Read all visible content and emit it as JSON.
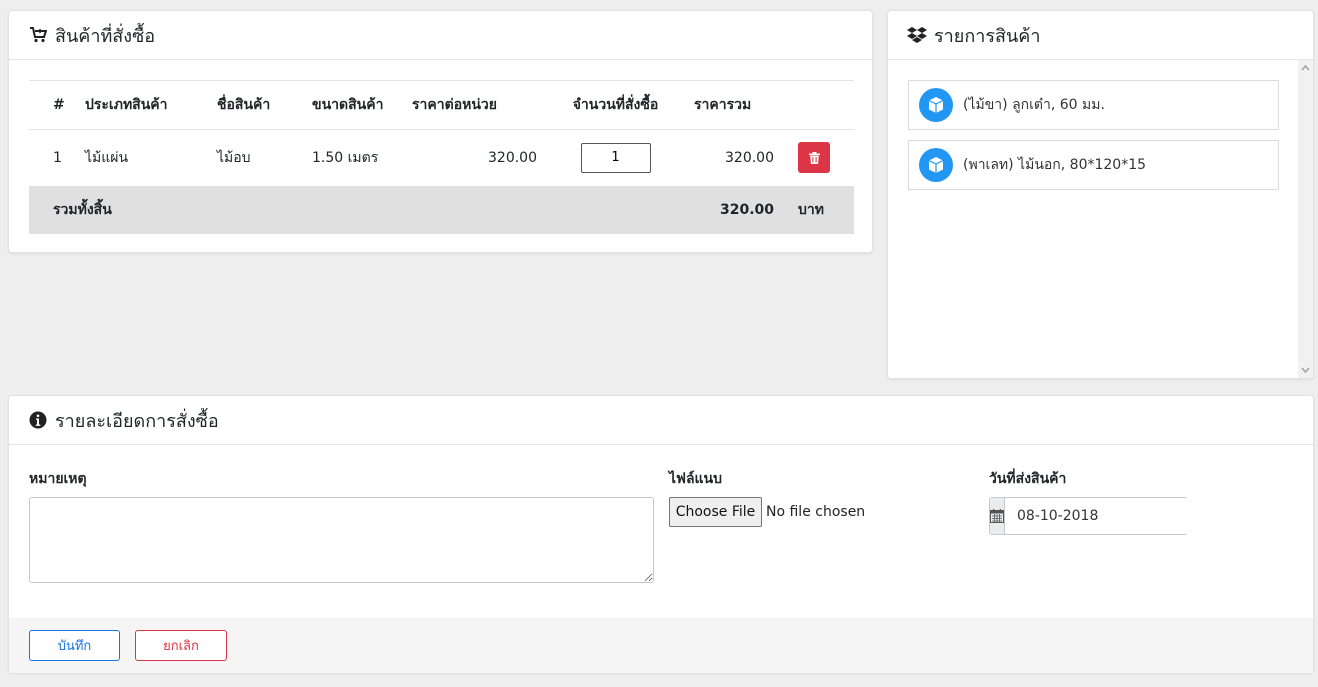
{
  "order": {
    "title": "สินค้าที่สั่งซื้อ",
    "columns": [
      "#",
      "ประเภทสินค้า",
      "ชื่อสินค้า",
      "ขนาดสินค้า",
      "ราคาต่อหน่วย",
      "จำนวนที่สั่งซื้อ",
      "ราคารวม"
    ],
    "rows": [
      {
        "no": "1",
        "type": "ไม้แผ่น",
        "name": "ไม้อบ",
        "size": "1.50 เมตร",
        "unit_price": "320.00",
        "qty": "1",
        "total": "320.00"
      }
    ],
    "total_label": "รวมทั้งสิ้น",
    "total_value": "320.00",
    "currency": "บาท"
  },
  "products": {
    "title": "รายการสินค้า",
    "items": [
      {
        "label": "(ไม้ขา) ลูกเต๋า, 60 มม."
      },
      {
        "label": "(พาเลท) ไม้นอก, 80*120*15"
      }
    ]
  },
  "details": {
    "title": "รายละเอียดการสั่งซื้อ",
    "remarks_label": "หมายเหตุ",
    "remarks_value": "",
    "attachment_label": "ไฟล์แนบ",
    "file_button": "Choose File",
    "file_status": "No file chosen",
    "delivery_label": "วันที่ส่งสินค้า",
    "delivery_date": "08-10-2018",
    "save_label": "บันทึก",
    "cancel_label": "ยกเลิก"
  },
  "colors": {
    "accent_blue": "#1a73e8",
    "danger_red": "#dc3545",
    "product_icon_blue": "#2196f3"
  }
}
